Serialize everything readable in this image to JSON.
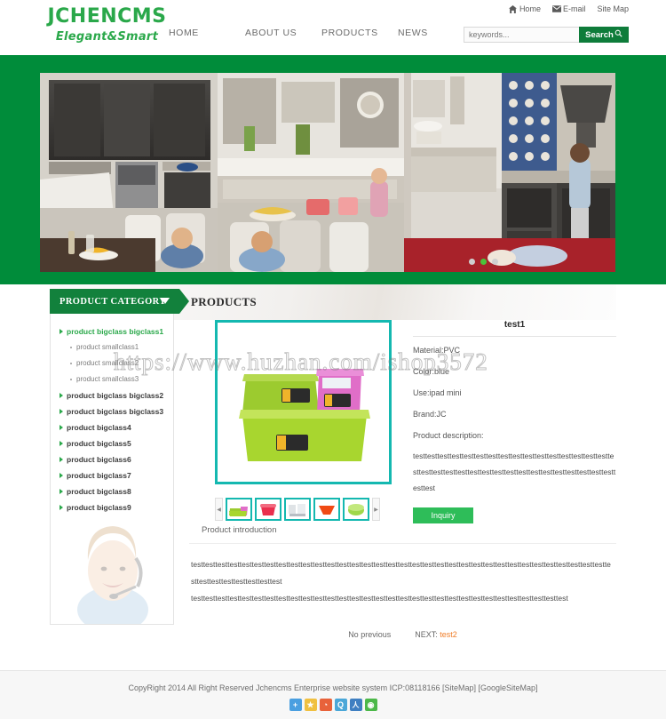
{
  "header": {
    "logo_main": "JCHENCMS",
    "logo_sub": "Elegant&Smart",
    "toplinks": [
      {
        "label": "Home",
        "icon": "home-icon"
      },
      {
        "label": "E-mail",
        "icon": "envelope-icon"
      },
      {
        "label": "Site Map",
        "icon": ""
      }
    ],
    "nav": [
      {
        "label": "HOME"
      },
      {
        "label": "ABOUT US"
      },
      {
        "label": "PRODUCTS"
      },
      {
        "label": "NEWS"
      }
    ],
    "search": {
      "placeholder": "keywords...",
      "value": "",
      "button_label": "Search",
      "button_icon": "search-icon",
      "button_color": "#0e7c3a"
    }
  },
  "banner": {
    "alt": "family kitchen interior photo",
    "dots": [
      "inactive",
      "active",
      "inactive"
    ],
    "background_color": "#008c3a",
    "active_dot_color": "#4bc43a"
  },
  "sidebar": {
    "panel_title": "PRODUCT CATEGORY",
    "panel_arrow_icon": "chevron-down-icon",
    "items": [
      {
        "label": "product bigclass bigclass1",
        "level": "big",
        "active": true
      },
      {
        "label": "product smallclass1",
        "level": "small",
        "active": false
      },
      {
        "label": "product smallclass2",
        "level": "small",
        "active": false
      },
      {
        "label": "product smallclass3",
        "level": "small",
        "active": false
      },
      {
        "label": "product bigclass bigclass2",
        "level": "big",
        "active": false
      },
      {
        "label": "product bigclass bigclass3",
        "level": "big",
        "active": false
      },
      {
        "label": "product bigclass4",
        "level": "big",
        "active": false
      },
      {
        "label": "product bigclass5",
        "level": "big",
        "active": false
      },
      {
        "label": "product bigclass6",
        "level": "big",
        "active": false
      },
      {
        "label": "product bigclass7",
        "level": "big",
        "active": false
      },
      {
        "label": "product bigclass8",
        "level": "big",
        "active": false
      },
      {
        "label": "product bigclass9",
        "level": "big",
        "active": false
      }
    ],
    "service_image_alt": "smiling customer-service agent with headset"
  },
  "main": {
    "page_title": "PRODUCTS",
    "product": {
      "name": "test1",
      "main_image_alt": "green and pink plastic storage boxes",
      "attributes": [
        "Material:PVC",
        "Color:blue",
        "Use:ipad mini",
        "Brand:JC"
      ],
      "description_label": "Product description:",
      "description": "testtesttesttesttesttesttesttesttesttesttesttesttesttesttesttesttesttesttesttesttesttesttesttesttesttesttesttesttesttesttesttesttesttesttest",
      "inquiry_label": "Inquiry",
      "inquiry_color": "#2ebd59",
      "thumbs": [
        {
          "alt": "green and pink storage boxes",
          "selected": true
        },
        {
          "alt": "red plastic basin"
        },
        {
          "alt": "clear plastic containers"
        },
        {
          "alt": "orange plastic bowl"
        },
        {
          "alt": "green plastic cups"
        }
      ],
      "thumb_prev_icon": "chevron-left-icon",
      "thumb_next_icon": "chevron-right-icon"
    },
    "introduction": {
      "heading": "Product introduction",
      "line1": "testtesttesttesttesttesttesttesttesttesttesttesttesttesttesttesttesttesttesttesttesttesttesttesttesttesttesttesttesttesttesttesttesttesttesttesttesttesttesttesttesttest",
      "line2": "testtesttesttesttesttesttesttesttesttesttesttesttesttesttesttesttesttesttesttesttesttesttesttesttesttesttesttesttesttesttest"
    },
    "pager": {
      "previous": "No previous",
      "next_label": "NEXT:",
      "next_value": "test2",
      "next_color": "#ef7d28"
    }
  },
  "footer": {
    "copyright": "CopyRight 2014 All Right Reserved Jchencms Enterprise website system ICP:08118166 [SiteMap] [GoogleSiteMap]",
    "social": [
      {
        "name": "share-plus-icon",
        "glyph": "+",
        "color": "#4a9fe0"
      },
      {
        "name": "favorite-star-icon",
        "glyph": "★",
        "color": "#f0c040"
      },
      {
        "name": "rss-feed-icon",
        "glyph": "◔",
        "color": "#e8623a"
      },
      {
        "name": "qzone-icon",
        "glyph": "Q",
        "color": "#4aa7d8"
      },
      {
        "name": "renren-icon",
        "glyph": "人",
        "color": "#3f7fc1"
      },
      {
        "name": "wechat-icon",
        "glyph": "◉",
        "color": "#4cb849"
      }
    ]
  },
  "watermarks": {
    "top": "https://www.huzhan.com/ishop3572"
  }
}
